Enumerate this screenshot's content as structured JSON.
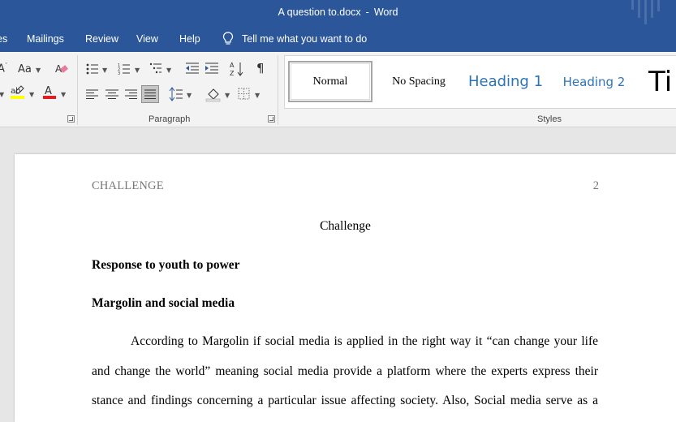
{
  "window": {
    "doc_name": "A question to.docx",
    "separator": "-",
    "app_name": "Word"
  },
  "menu": {
    "tabs": [
      "es",
      "Mailings",
      "Review",
      "View",
      "Help"
    ],
    "tell_me": "Tell me what you want to do"
  },
  "ribbon": {
    "paragraph_label": "Paragraph",
    "styles_label": "Styles",
    "font_size_label": "Aa",
    "styles": [
      "Normal",
      "No Spacing",
      "Heading 1",
      "Heading 2",
      "Ti"
    ]
  },
  "document": {
    "header_left": "CHALLENGE",
    "header_right": "2",
    "title": "Challenge",
    "heading1": "Response to youth to power",
    "heading2": "Margolin and social media",
    "lines": [
      "According to Margolin if social media is applied in the right way it “can change your life",
      "and change the world” meaning social media provide a platform where the experts express their",
      "stance and findings concerning a particular issue affecting society. Also, Social media serve as a"
    ]
  },
  "colors": {
    "title_bar": "#2b579a",
    "ribbon_bg": "#f3f3f3",
    "heading_style": "#2e74b5",
    "font_color_bar": "#e02020",
    "highlight_bar": "#ffff00"
  }
}
